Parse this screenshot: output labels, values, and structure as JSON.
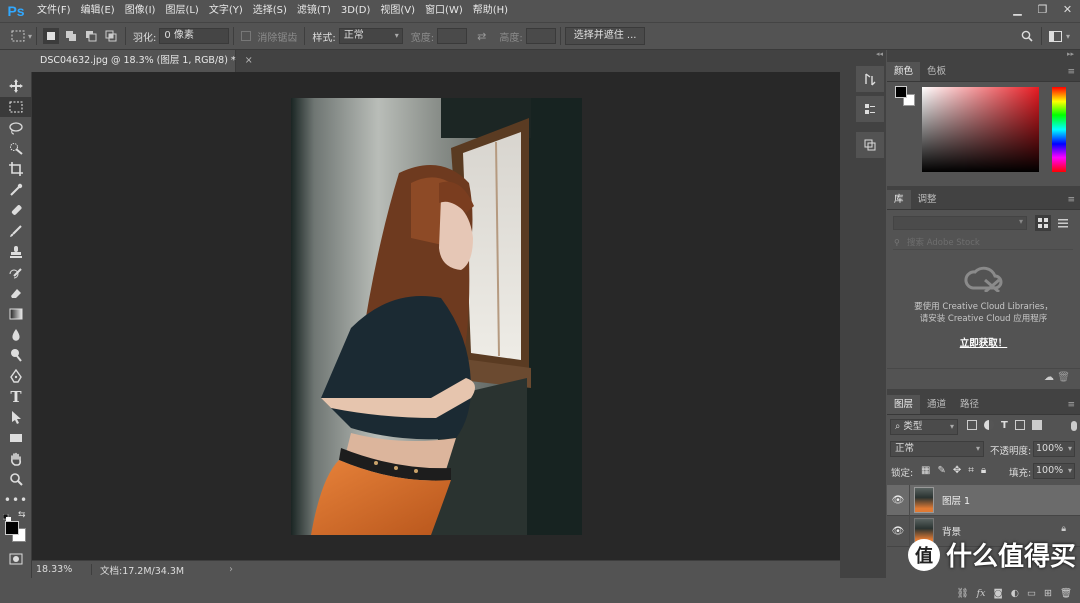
{
  "app": {
    "logo": "Ps"
  },
  "menu": [
    "文件(F)",
    "编辑(E)",
    "图像(I)",
    "图层(L)",
    "文字(Y)",
    "选择(S)",
    "滤镜(T)",
    "3D(D)",
    "视图(V)",
    "窗口(W)",
    "帮助(H)"
  ],
  "options": {
    "feather_label": "羽化:",
    "feather_value": "0 像素",
    "antialias_label": "消除锯齿",
    "style_label": "样式:",
    "style_value": "正常",
    "width_label": "宽度:",
    "height_label": "高度:",
    "select_mask_button": "选择并遮住 ..."
  },
  "document": {
    "tab_title": "DSC04632.jpg @ 18.3% (图层 1, RGB/8) *",
    "close": "×"
  },
  "status": {
    "zoom": "18.33%",
    "doc_info": "文档:17.2M/34.3M",
    "arrow": "›"
  },
  "panels": {
    "color_tabs": [
      "颜色",
      "色板"
    ],
    "library_tabs": [
      "库",
      "调整"
    ],
    "library_search_placeholder": "搜索 Adobe Stock",
    "library_message_1": "要使用 Creative Cloud Libraries，",
    "library_message_2": "请安装 Creative Cloud 应用程序",
    "library_link": "立即获取！",
    "layers_tabs": [
      "图层",
      "通道",
      "路径"
    ],
    "filter_kind": "类型",
    "blend_mode": "正常",
    "opacity_label": "不透明度:",
    "opacity_value": "100%",
    "lock_label": "锁定:",
    "fill_label": "填充:",
    "fill_value": "100%",
    "layers": [
      {
        "name": "图层 1",
        "selected": true,
        "locked": false
      },
      {
        "name": "背景",
        "selected": false,
        "locked": true
      }
    ],
    "layer_footer_icons": [
      "fx"
    ]
  },
  "watermark": {
    "text": "什么值得买"
  },
  "colors": {
    "ps_blue": "#31a8ff",
    "bg": "#535353",
    "canvas": "#282828",
    "selected_layer": "#6b6b6b"
  }
}
